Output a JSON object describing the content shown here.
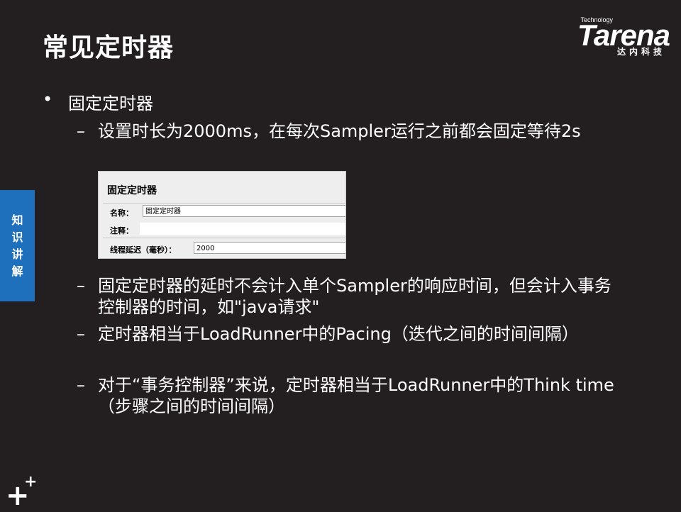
{
  "slide": {
    "title": "常见定时器",
    "logo": {
      "word": "Tarena",
      "tagline": "Technology",
      "cn": "达内科技"
    },
    "side_tab": "知识讲解",
    "bullet": "固定定时器",
    "sub_items": [
      "设置时长为2000ms，在每次Sampler运行之前都会固定等待2s",
      "固定定时器的延时不会计入单个Sampler的响应时间，但会计入事务控制器的时间，如\"java请求\"",
      "定时器相当于LoadRunner中的Pacing（迭代之间的时间间隔）",
      " 对于“事务控制器”来说，定时器相当于LoadRunner中的Think time（步骤之间的时间间隔）"
    ],
    "dash": "–",
    "dot": "•",
    "screenshot": {
      "title": "固定定时器",
      "name_label": "名称：",
      "name_value": "固定定时器",
      "comment_label": "注释：",
      "delay_label": "线程延迟（毫秒）：",
      "delay_value": "2000"
    },
    "corner_icon": "plus-icon"
  }
}
